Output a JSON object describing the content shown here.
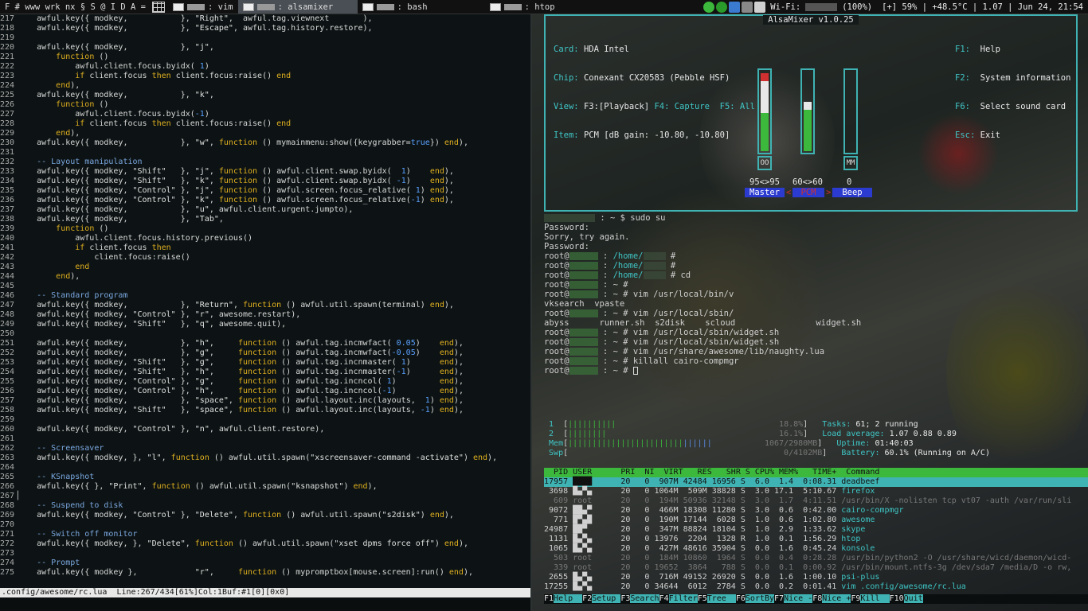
{
  "topbar": {
    "prefix": "F # www wrk nx § S @ I D A =",
    "tasks": [
      {
        "label": ": vim",
        "active": false
      },
      {
        "label": ": alsamixer",
        "active": true
      },
      {
        "label": ": bash",
        "active": false
      },
      {
        "label": ": htop",
        "active": false
      }
    ],
    "wifi": "Wi-Fi:",
    "battery_pct": "(100%)",
    "status": "[+] 59% | +48.5°C | 1.07 | Jun 24, 21:54"
  },
  "editor": {
    "lines": [
      [
        "217",
        "    awful.key({ modkey,           }, \"Right\",  awful.tag.viewnext       ),"
      ],
      [
        "218",
        "    awful.key({ modkey,           }, \"Escape\", awful.tag.history.restore),"
      ],
      [
        "219",
        ""
      ],
      [
        "220",
        "    awful.key({ modkey,           }, \"j\","
      ],
      [
        "221",
        "        function ()"
      ],
      [
        "222",
        "            awful.client.focus.byidx( 1)"
      ],
      [
        "223",
        "            if client.focus then client.focus:raise() end"
      ],
      [
        "224",
        "        end),"
      ],
      [
        "225",
        "    awful.key({ modkey,           }, \"k\","
      ],
      [
        "226",
        "        function ()"
      ],
      [
        "227",
        "            awful.client.focus.byidx(-1)"
      ],
      [
        "228",
        "            if client.focus then client.focus:raise() end"
      ],
      [
        "229",
        "        end),"
      ],
      [
        "230",
        "    awful.key({ modkey,           }, \"w\", function () mymainmenu:show({keygrabber=true}) end),"
      ],
      [
        "231",
        ""
      ],
      [
        "232",
        "    -- Layout manipulation"
      ],
      [
        "233",
        "    awful.key({ modkey, \"Shift\"   }, \"j\", function () awful.client.swap.byidx(  1)    end),"
      ],
      [
        "234",
        "    awful.key({ modkey, \"Shift\"   }, \"k\", function () awful.client.swap.byidx( -1)    end),"
      ],
      [
        "235",
        "    awful.key({ modkey, \"Control\" }, \"j\", function () awful.screen.focus_relative( 1) end),"
      ],
      [
        "236",
        "    awful.key({ modkey, \"Control\" }, \"k\", function () awful.screen.focus_relative(-1) end),"
      ],
      [
        "237",
        "    awful.key({ modkey,           }, \"u\", awful.client.urgent.jumpto),"
      ],
      [
        "238",
        "    awful.key({ modkey,           }, \"Tab\","
      ],
      [
        "239",
        "        function ()"
      ],
      [
        "240",
        "            awful.client.focus.history.previous()"
      ],
      [
        "241",
        "            if client.focus then"
      ],
      [
        "242",
        "                client.focus:raise()"
      ],
      [
        "243",
        "            end"
      ],
      [
        "244",
        "        end),"
      ],
      [
        "245",
        ""
      ],
      [
        "246",
        "    -- Standard program"
      ],
      [
        "247",
        "    awful.key({ modkey,           }, \"Return\", function () awful.util.spawn(terminal) end),"
      ],
      [
        "248",
        "    awful.key({ modkey, \"Control\" }, \"r\", awesome.restart),"
      ],
      [
        "249",
        "    awful.key({ modkey, \"Shift\"   }, \"q\", awesome.quit),"
      ],
      [
        "250",
        ""
      ],
      [
        "251",
        "    awful.key({ modkey,           }, \"h\",     function () awful.tag.incmwfact( 0.05)    end),"
      ],
      [
        "252",
        "    awful.key({ modkey,           }, \"g\",     function () awful.tag.incmwfact(-0.05)    end),"
      ],
      [
        "253",
        "    awful.key({ modkey, \"Shift\"   }, \"g\",     function () awful.tag.incnmaster( 1)      end),"
      ],
      [
        "254",
        "    awful.key({ modkey, \"Shift\"   }, \"h\",     function () awful.tag.incnmaster(-1)      end),"
      ],
      [
        "255",
        "    awful.key({ modkey, \"Control\" }, \"g\",     function () awful.tag.incncol( 1)         end),"
      ],
      [
        "256",
        "    awful.key({ modkey, \"Control\" }, \"h\",     function () awful.tag.incncol(-1)         end),"
      ],
      [
        "257",
        "    awful.key({ modkey,           }, \"space\", function () awful.layout.inc(layouts,  1) end),"
      ],
      [
        "258",
        "    awful.key({ modkey, \"Shift\"   }, \"space\", function () awful.layout.inc(layouts, -1) end),"
      ],
      [
        "259",
        ""
      ],
      [
        "260",
        "    awful.key({ modkey, \"Control\" }, \"n\", awful.client.restore),"
      ],
      [
        "261",
        ""
      ],
      [
        "262",
        "    -- Screensaver"
      ],
      [
        "263",
        "    awful.key({ modkey, }, \"l\", function () awful.util.spawn(\"xscreensaver-command -activate\") end),"
      ],
      [
        "264",
        ""
      ],
      [
        "265",
        "    -- KSnapshot"
      ],
      [
        "266",
        "    awful.key({ }, \"Print\", function () awful.util.spawn(\"ksnapshot\") end),"
      ],
      [
        "267",
        "▏"
      ],
      [
        "268",
        "    -- Suspend to disk"
      ],
      [
        "269",
        "    awful.key({ modkey, \"Control\" }, \"Delete\", function () awful.util.spawn(\"s2disk\") end),"
      ],
      [
        "270",
        ""
      ],
      [
        "271",
        "    -- Switch off monitor"
      ],
      [
        "272",
        "    awful.key({ modkey, }, \"Delete\", function () awful.util.spawn(\"xset dpms force off\") end),"
      ],
      [
        "273",
        ""
      ],
      [
        "274",
        "    -- Prompt"
      ],
      [
        "275",
        "    awful.key({ modkey },            \"r\",     function () mypromptbox[mouse.screen]:run() end),"
      ]
    ],
    "statusline": ".config/awesome/rc.lua  Line:267/434[61%]Col:1Buf:#1[0][0x0]"
  },
  "alsamixer": {
    "title": "AlsaMixer v1.0.25",
    "card": "HDA Intel",
    "chip": "Conexant CX20583 (Pebble HSF)",
    "view_prefix": "F3:",
    "view_playback": "[Playback]",
    "view_rest": "F4: Capture  F5: All",
    "item": "PCM [dB gain: -10.80, -10.80]",
    "keys": [
      {
        "key": "F1:",
        "label": "Help"
      },
      {
        "key": "F2:",
        "label": "System information"
      },
      {
        "key": "F6:",
        "label": "Select sound card"
      },
      {
        "key": "Esc:",
        "label": "Exit"
      }
    ],
    "channels": [
      {
        "name": "Master",
        "values": "95<>95",
        "box": "OO",
        "level": 0.95
      },
      {
        "name": "PCM",
        "values": "60<>60",
        "box": "",
        "level": 0.6
      },
      {
        "name": "Beep",
        "values": "0",
        "box": "MM",
        "level": 0.0
      }
    ]
  },
  "terminal": {
    "lines": [
      ": ~ $ sudo su",
      "Password:",
      "Sorry, try again.",
      "Password:",
      "/home/ #",
      "/home/ #",
      "/home/ # cd",
      "~ #",
      "~ # vim /usr/local/bin/v",
      "vksearch  vpaste",
      "~ # vim /usr/local/sbin/",
      "abyss      runner.sh  s2disk    scloud                widget.sh",
      "~ # vim /usr/local/sbin/widget.sh",
      "~ # vim /usr/local/sbin/widget.sh",
      "~ # vim /usr/share/awesome/lib/naughty.lua",
      "~ # killall cairo-compmgr",
      "~ # "
    ],
    "root_prefix": "root@"
  },
  "htop": {
    "cpu1": {
      "label": "1",
      "pct": "18.8%"
    },
    "cpu2": {
      "label": "2",
      "pct": "16.1%"
    },
    "mem": {
      "label": "Mem",
      "value": "1067/2980MB"
    },
    "swp": {
      "label": "Swp",
      "value": "0/4102MB"
    },
    "tasks_label": "Tasks:",
    "tasks_value": "61; 2 running",
    "load_label": "Load average:",
    "load_value": "1.07 0.88 0.89",
    "uptime_label": "Uptime:",
    "uptime_value": "01:40:03",
    "battery_label": "Battery:",
    "battery_value": "60.1% (Running on A/C)",
    "header": "  PID USER      PRI  NI  VIRT   RES   SHR S CPU% MEM%   TIME+  Command",
    "rows": [
      "17957 ████      20   0  907M 42484 16956 S  6.0  1.4  0:08.31 deadbeef",
      " 3698 █▄▀▄      20   0 1064M  509M 38828 S  3.0 17.1  5:10.67 firefox",
      "  609 root      20   0  194M 50936 32148 S  3.0  1.7  4:11.51 /usr/bin/X -nolisten tcp vt07 -auth /var/run/sli",
      " 9072 ██▄▀      20   0  466M 18308 11280 S  3.0  0.6  0:42.00 cairo-compmgr",
      "  771 █▀▄█      20   0  190M 17144  6028 S  1.0  0.6  1:02.80 awesome",
      "24987 ██▀       20   0  347M 88824 18104 S  1.0  2.9  1:33.62 skype",
      " 1131 █▄▀▄      20   0 13976  2204  1328 R  1.0  0.1  1:56.29 htop",
      " 1065 █▄▀▄      20   0  427M 48616 35904 S  0.0  1.6  0:45.24 konsole",
      "  503 root      20   0  184M 10860  1964 S  0.0  0.4  0:28.28 /usr/bin/python2 -O /usr/share/wicd/daemon/wicd-",
      "  339 root      20   0 19652  3864   788 S  0.0  0.1  0:00.92 /usr/bin/mount.ntfs-3g /dev/sda7 /media/D -o rw,",
      " 2655 █▄▀▄      20   0  716M 49152 26920 S  0.0  1.6  1:00.10 psi-plus",
      "17255 █▄▀▄      20   0 34644  6012  2784 S  0.0  0.2  0:01.41 vim .config/awesome/rc.lua"
    ],
    "fkeys": [
      {
        "k": "F1",
        "l": "Help  "
      },
      {
        "k": "F2",
        "l": "Setup "
      },
      {
        "k": "F3",
        "l": "Search"
      },
      {
        "k": "F4",
        "l": "Filter"
      },
      {
        "k": "F5",
        "l": "Tree  "
      },
      {
        "k": "F6",
        "l": "SortBy"
      },
      {
        "k": "F7",
        "l": "Nice -"
      },
      {
        "k": "F8",
        "l": "Nice +"
      },
      {
        "k": "F9",
        "l": "Kill  "
      },
      {
        "k": "F10",
        "l": "Quit"
      }
    ]
  },
  "colors": {
    "accent_cyan": "#3fb3b3",
    "green": "#3cb83c",
    "keyword": "#e0b020",
    "comment": "#7aa7e0"
  }
}
